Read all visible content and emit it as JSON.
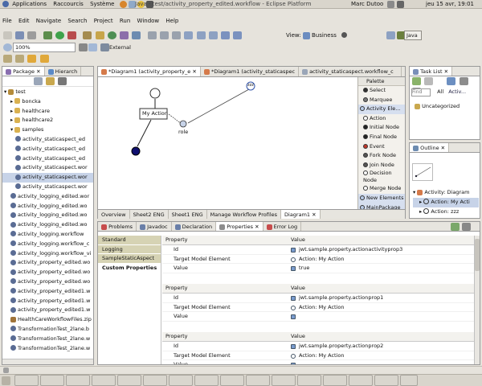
{
  "top_panel": {
    "menu": [
      "Applications",
      "Raccourcis",
      "Système"
    ],
    "window_title": "Java - test/activity_property_edited.workflow - Eclipse Platform",
    "user": "Marc Dutoo",
    "datetime": "jeu 15 avr, 19:01"
  },
  "menubar": [
    "File",
    "Edit",
    "Navigate",
    "Search",
    "Project",
    "Run",
    "Window",
    "Help"
  ],
  "toolbar": {
    "view_label": "View:",
    "view_value": "Business",
    "perspective": "Java",
    "zoom": "100%",
    "external": "External"
  },
  "left_panel": {
    "tabs": [
      "Package",
      "Hierarch"
    ],
    "tree": [
      "test",
      "boncka",
      "healthcare",
      "healthcare2",
      "samples",
      "activity_staticaspect_ed",
      "activity_staticaspect_ed",
      "activity_staticaspect_ed",
      "activity_staticaspect.wor",
      "activity_staticaspect.wor",
      "activity_staticaspect.wor",
      "activity_logging_edited.wor",
      "activity_logging_edited.wo",
      "activity_logging_edited.wo",
      "activity_logging_edited.wo",
      "activity_logging.workflow",
      "activity_logging.workflow_c",
      "activity_logging.workflow_vi",
      "activity_property_edited.wo",
      "activity_property_edited.wo",
      "activity_property_edited.wo",
      "activity_property_edited1.w",
      "activity_property_edited1.w",
      "activity_property_edited1.w",
      "HealthCareWorkflowFiles.zip",
      "TransformationTest_2lane.b",
      "TransformationTest_2lane.w",
      "TransformationTest_2lane.w"
    ]
  },
  "editor": {
    "tabs": [
      "*Diagram1 (activity_property_e",
      "*Diagram1 (activity_staticaspec",
      "activity_staticaspect.workflow_c"
    ],
    "diagram": {
      "action_label": "My Action",
      "role_label": "role",
      "role_icon": "role-icon"
    },
    "palette": {
      "title": "Palette",
      "items": [
        "Select",
        "Marquee",
        "Activity Ele...",
        "Action",
        "Initial Node",
        "Final Node",
        "Event",
        "Fork Node",
        "Join Node",
        "Decision Node",
        "Merge Node",
        "New Elements",
        "MainPackage"
      ]
    },
    "bottom_tabs": [
      "Overview",
      "Sheet2 ENG",
      "Sheet1 ENG",
      "Manage Workflow Profiles",
      "Diagram1"
    ]
  },
  "task_list": {
    "title": "Task List",
    "find_placeholder": "Find",
    "filter_all": "All",
    "filter_activate": "Activ...",
    "item": "Uncategorized"
  },
  "outline": {
    "title": "Outline",
    "tree": [
      "Activity: Diagram",
      "Action: My Acti",
      "Action: zzz"
    ]
  },
  "bottom_panel": {
    "tabs": [
      "Problems",
      "Javadoc",
      "Declaration",
      "Properties",
      "Error Log"
    ],
    "categories": [
      "Standard",
      "Logging",
      "SampleStaticAspect",
      "Custom Properties"
    ],
    "sections": [
      {
        "header_property": "Property",
        "header_value": "Value",
        "rows": [
          {
            "property": "Id",
            "value": "jwt.sample.property.actionactivityprop3"
          },
          {
            "property": "Target Model Element",
            "value": "Action: My Action"
          },
          {
            "property": "Value",
            "value": "true"
          }
        ]
      },
      {
        "header_property": "Property",
        "header_value": "Value",
        "rows": [
          {
            "property": "Id",
            "value": "jwt.sample.property.actionprop1"
          },
          {
            "property": "Target Model Element",
            "value": "Action: My Action"
          },
          {
            "property": "Value",
            "value": ""
          }
        ]
      },
      {
        "header_property": "Property",
        "header_value": "Value",
        "rows": [
          {
            "property": "Id",
            "value": "jwt.sample.property.actionprop2"
          },
          {
            "property": "Target Model Element",
            "value": "Action: My Action"
          },
          {
            "property": "Value",
            "value": ""
          }
        ]
      }
    ]
  },
  "colors": {
    "selection": "#c7d3e8",
    "palette_header": "#d6dfef",
    "category_active": "#d6d3b4"
  }
}
